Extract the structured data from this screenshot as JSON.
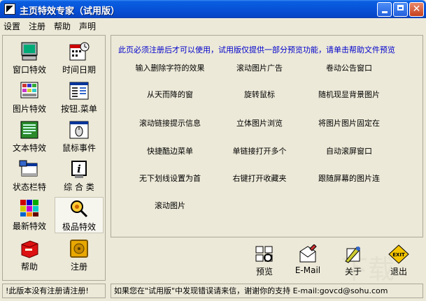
{
  "window": {
    "title": "主页特效专家（试用版）"
  },
  "menu": [
    "设置",
    "注册",
    "帮助",
    "声明"
  ],
  "tools": [
    {
      "label": "窗口特效",
      "icon": "monitor-icon"
    },
    {
      "label": "时间日期",
      "icon": "calendar-clock-icon"
    },
    {
      "label": "图片特效",
      "icon": "image-grid-icon"
    },
    {
      "label": "按钮.菜单",
      "icon": "menu-list-icon"
    },
    {
      "label": "文本特效",
      "icon": "text-document-icon"
    },
    {
      "label": "鼠标事件",
      "icon": "mouse-window-icon"
    },
    {
      "label": "状态栏特",
      "icon": "status-bar-icon"
    },
    {
      "label": "综 合 类",
      "icon": "info-icon"
    },
    {
      "label": "最新特效",
      "icon": "color-blocks-icon"
    },
    {
      "label": "极品特效",
      "icon": "magnifier-gear-icon"
    },
    {
      "label": "帮助",
      "icon": "help-book-icon"
    },
    {
      "label": "注册",
      "icon": "safe-icon"
    }
  ],
  "notice": "此页必须注册后才可以使用，试用版仅提供一部分预览功能，请单击帮助文件预览",
  "effects": [
    "输入删除字符的效果",
    "滚动图片广告",
    "卷动公告窗口",
    "从天而降的窗",
    "旋转鼠标",
    "随机现显背景图片",
    "滚动链接提示信息",
    "立体图片浏览",
    "将图片图片固定在",
    "快捷酷边菜单",
    "单链接打开多个",
    "自动滚屏窗口",
    "无下划线设置为首",
    "右键打开收藏夹",
    "跟随屏幕的图片连",
    "滚动图片"
  ],
  "bottom_buttons": [
    {
      "label": "预览",
      "icon": "preview-icon"
    },
    {
      "label": "E-Mail",
      "icon": "email-icon"
    },
    {
      "label": "关于",
      "icon": "about-icon"
    },
    {
      "label": "退出",
      "icon": "exit-icon"
    }
  ],
  "exit_sign_text": "EXIT",
  "status": {
    "left": "!此版本没有注册请注册!",
    "right": "如果您在\"试用版\"中发现错误请来信，谢谢你的支持 E-mail:govcd@sohu.com"
  },
  "watermark": "下载"
}
